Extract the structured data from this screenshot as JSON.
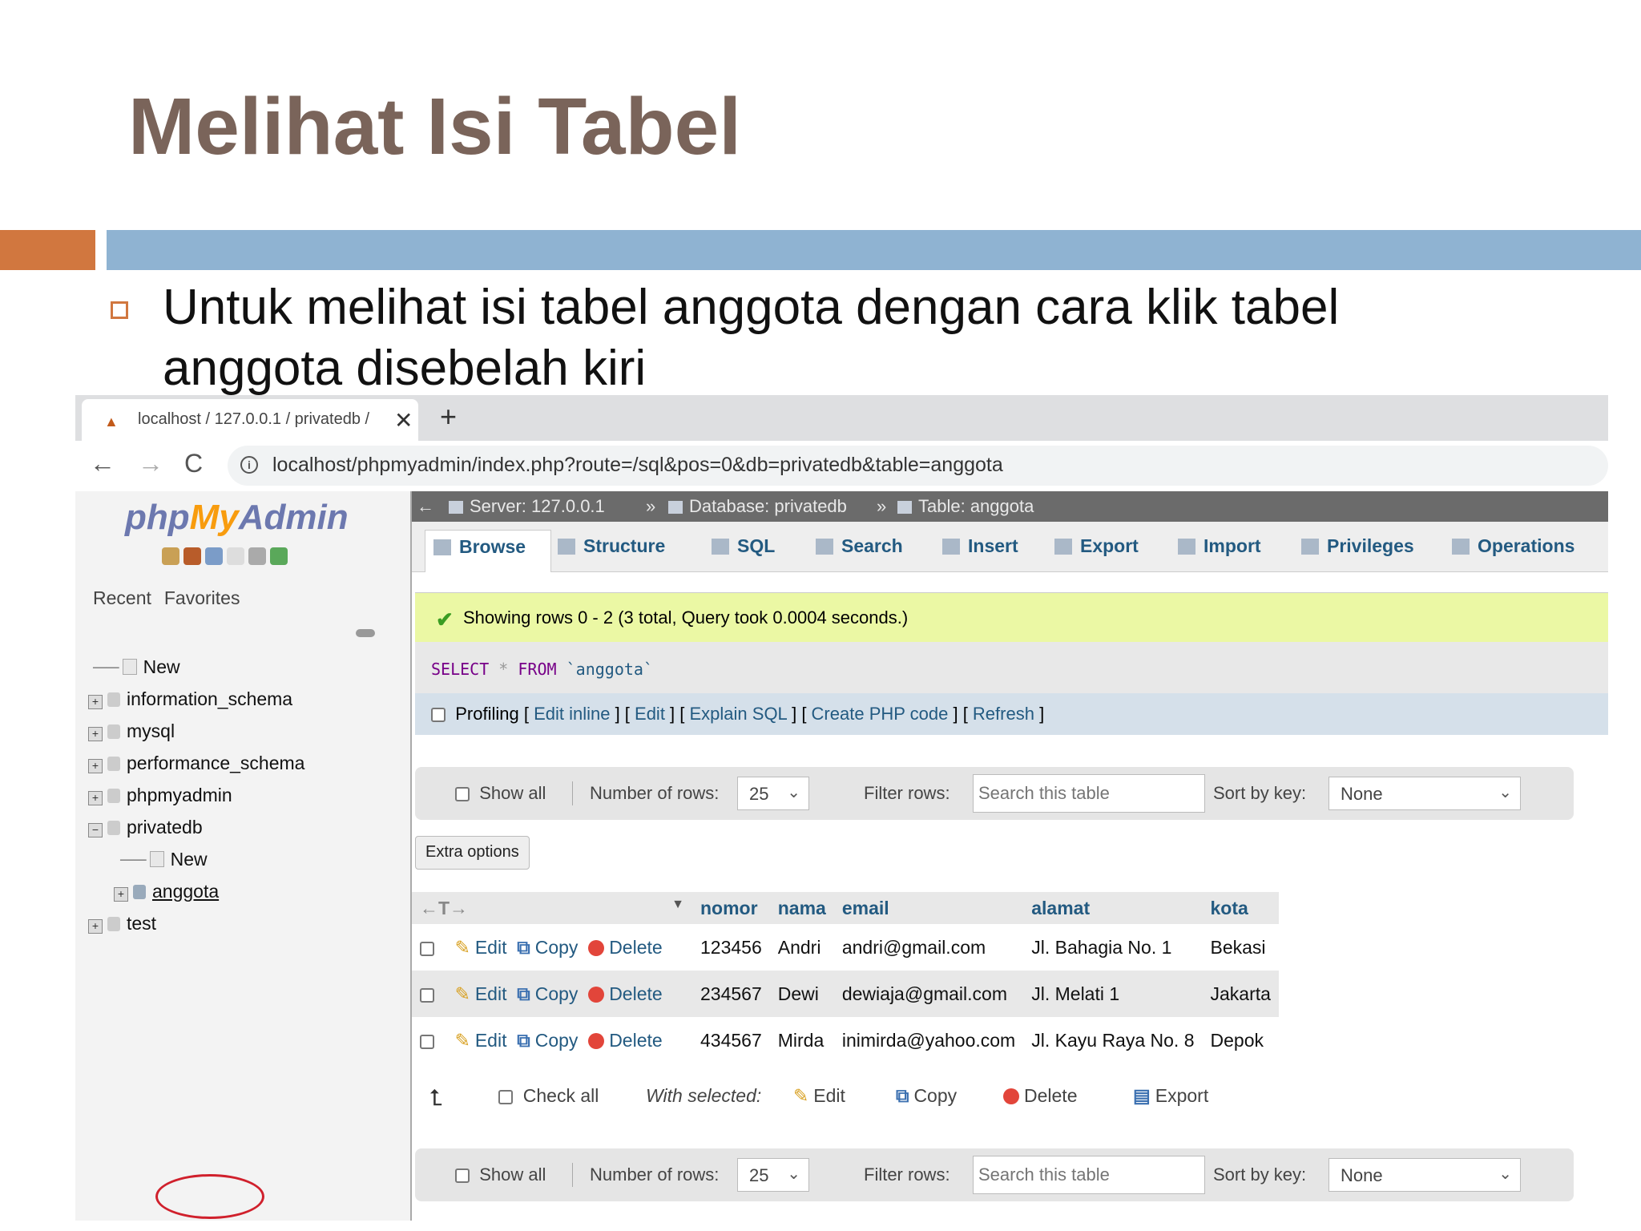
{
  "slide": {
    "title": "Melihat Isi Tabel",
    "bullet": "Untuk melihat isi tabel anggota dengan cara klik tabel anggota disebelah kiri"
  },
  "browser": {
    "tab_title": "localhost / 127.0.0.1 / privatedb /",
    "tab_close": "✕",
    "new_tab": "+",
    "url": "localhost/phpmyadmin/index.php?route=/sql&pos=0&db=privatedb&table=anggota",
    "nav": {
      "back": "←",
      "forward": "→",
      "reload": "C"
    }
  },
  "sidebar": {
    "logo": {
      "php": "php",
      "my": "My",
      "admin": "Admin"
    },
    "tabs": [
      "Recent",
      "Favorites"
    ],
    "tree": [
      {
        "label": "New",
        "type": "new"
      },
      {
        "label": "information_schema",
        "type": "db"
      },
      {
        "label": "mysql",
        "type": "db"
      },
      {
        "label": "performance_schema",
        "type": "db"
      },
      {
        "label": "phpmyadmin",
        "type": "db"
      },
      {
        "label": "privatedb",
        "type": "db-open"
      },
      {
        "label": "New",
        "type": "new-child"
      },
      {
        "label": "anggota",
        "type": "table"
      },
      {
        "label": "test",
        "type": "db"
      }
    ]
  },
  "breadcrumb": {
    "back": "←",
    "server": "Server: 127.0.0.1",
    "sep": "»",
    "database": "Database: privatedb",
    "table": "Table: anggota"
  },
  "menu": [
    "Browse",
    "Structure",
    "SQL",
    "Search",
    "Insert",
    "Export",
    "Import",
    "Privileges",
    "Operations"
  ],
  "success_message": "Showing rows 0 - 2 (3 total, Query took 0.0004 seconds.)",
  "sql": {
    "select": "SELECT",
    "star": "*",
    "from": "FROM",
    "table": "`anggota`"
  },
  "profiling": {
    "label": "Profiling",
    "links": [
      "Edit inline",
      "Edit",
      "Explain SQL",
      "Create PHP code",
      "Refresh"
    ]
  },
  "navbar": {
    "show_all": "Show all",
    "number_of_rows_label": "Number of rows:",
    "number_of_rows_value": "25",
    "filter_rows_label": "Filter rows:",
    "search_placeholder": "Search this table",
    "sort_by_key_label": "Sort by key:",
    "sort_by_key_value": "None"
  },
  "extra_options": "Extra options",
  "table": {
    "columns": [
      "nomor",
      "nama",
      "email",
      "alamat",
      "kota"
    ],
    "row_actions": {
      "edit": "Edit",
      "copy": "Copy",
      "delete": "Delete"
    },
    "rows": [
      {
        "nomor": "123456",
        "nama": "Andri",
        "email": "andri@gmail.com",
        "alamat": "Jl. Bahagia No. 1",
        "kota": "Bekasi"
      },
      {
        "nomor": "234567",
        "nama": "Dewi",
        "email": "dewiaja@gmail.com",
        "alamat": "Jl. Melati 1",
        "kota": "Jakarta"
      },
      {
        "nomor": "434567",
        "nama": "Mirda",
        "email": "inimirda@yahoo.com",
        "alamat": "Jl. Kayu Raya No. 8",
        "kota": "Depok"
      }
    ]
  },
  "bottom_actions": {
    "check_all": "Check all",
    "with_selected": "With selected:",
    "edit": "Edit",
    "copy": "Copy",
    "delete": "Delete",
    "export": "Export"
  },
  "colors": {
    "title": "#7a645a",
    "accent_orange": "#d1773f",
    "accent_blue": "#8fb3d2",
    "link": "#235a81",
    "success_bg": "#ebf8a4"
  }
}
